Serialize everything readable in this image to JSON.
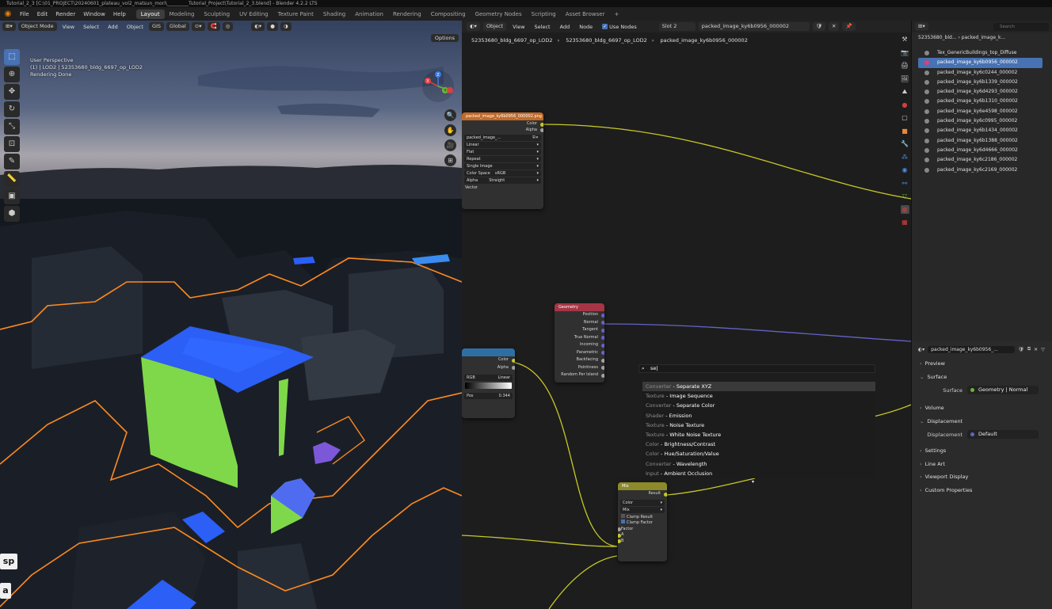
{
  "titlebar": {
    "text": "Tutorial_2_3 [C:\\01_PROJECT\\20240601_plateau_vol2_matsun_mori\\_________Tutorial_Project\\Tutorial_2_3.blend] - Blender 4.2.2 LTS"
  },
  "topbar": {
    "menus": [
      "File",
      "Edit",
      "Render",
      "Window",
      "Help"
    ],
    "workspaces": [
      "Layout",
      "Modeling",
      "Sculpting",
      "UV Editing",
      "Texture Paint",
      "Shading",
      "Animation",
      "Rendering",
      "Compositing",
      "Geometry Nodes",
      "Scripting",
      "Asset Browser"
    ],
    "add_tab": "+",
    "active_workspace": "Layout"
  },
  "viewport": {
    "mode": "Object Mode",
    "menus": [
      "View",
      "Select",
      "Add",
      "Object"
    ],
    "gis_label": "GIS",
    "orientation": "Global",
    "options_label": "Options",
    "info_lines": [
      "User Perspective",
      "(1) | LOD2 | 52353680_bldg_6697_op_LOD2",
      "Rendering Done"
    ],
    "key_overlays": [
      "sp",
      "a"
    ],
    "gizmo_labels": {
      "z": "Z",
      "y": "Y",
      "x": "X"
    }
  },
  "node_editor": {
    "editor_type": "Object",
    "menus": [
      "View",
      "Select",
      "Add",
      "Node"
    ],
    "use_nodes_label": "Use Nodes",
    "slot": "Slot 2",
    "material": "packed_image_ky6b0956_000002",
    "breadcrumb": [
      "52353680_bldg_6697_op_LOD2",
      "52353680_bldg_6697_op_LOD2",
      "packed_image_ky6b0956_000002"
    ],
    "image_node": {
      "title": "packed_image_ky6b0956_000002.png",
      "outputs": [
        "Color",
        "Alpha"
      ],
      "image_name": "packed_image_...",
      "interpolation": "Linear",
      "projection": "Flat",
      "extension": "Repeat",
      "source": "Single Image",
      "color_space_label": "Color Space",
      "color_space": "sRGB",
      "alpha_label": "Alpha",
      "alpha_mode": "Straight",
      "vector_label": "Vector"
    },
    "geometry_node": {
      "title": "Geometry",
      "outputs": [
        "Position",
        "Normal",
        "Tangent",
        "True Normal",
        "Incoming",
        "Parametric",
        "Backfacing",
        "Pointiness",
        "Random Per Island"
      ]
    },
    "ramp_node": {
      "outputs": [
        "Color",
        "Alpha"
      ],
      "mode": "RGB",
      "interp": "Linear",
      "pos_label": "Pos",
      "pos_value": "0.344"
    },
    "mix_node": {
      "title": "Mix",
      "output": "Result",
      "data_type": "Color",
      "blend": "Mix",
      "clamp_result": "Clamp Result",
      "clamp_factor": "Clamp Factor",
      "inputs": [
        "Factor",
        "A",
        "B"
      ]
    },
    "search": {
      "query": "se",
      "results": [
        {
          "category": "Converter",
          "name": "Separate XYZ"
        },
        {
          "category": "Texture",
          "name": "Image Sequence"
        },
        {
          "category": "Converter",
          "name": "Separate Color"
        },
        {
          "category": "Shader",
          "name": "Emission"
        },
        {
          "category": "Texture",
          "name": "Noise Texture"
        },
        {
          "category": "Texture",
          "name": "White Noise Texture"
        },
        {
          "category": "Color",
          "name": "Brightness/Contrast"
        },
        {
          "category": "Color",
          "name": "Hue/Saturation/Value"
        },
        {
          "category": "Converter",
          "name": "Wavelength"
        },
        {
          "category": "Input",
          "name": "Ambient Occlusion"
        }
      ]
    }
  },
  "outliner": {
    "search_placeholder": "Search",
    "breadcrumb": [
      "52353680_bld...",
      "packed_image_k..."
    ],
    "items": [
      "Tex_GenericBuildings_top_Diffuse",
      "packed_image_ky6b0956_000002",
      "packed_image_ky6c0244_000002",
      "packed_image_ky6b1339_000002",
      "packed_image_ky6d4293_000002",
      "packed_image_ky6b1310_000002",
      "packed_image_ky6e4598_000002",
      "packed_image_ky6c0995_000002",
      "packed_image_ky6b1434_000002",
      "packed_image_ky6b1388_000002",
      "packed_image_ky6d4666_000002",
      "packed_image_ky6c2186_000002",
      "packed_image_ky6c2169_000002"
    ],
    "selected_index": 1
  },
  "properties": {
    "material_name": "packed_image_ky6b0956_...",
    "panels": {
      "preview": "Preview",
      "surface": "Surface",
      "surface_label": "Surface",
      "surface_value": "Geometry | Normal",
      "volume": "Volume",
      "displacement": "Displacement",
      "displacement_label": "Displacement",
      "displacement_value": "Default",
      "settings": "Settings",
      "line_art": "Line Art",
      "viewport_display": "Viewport Display",
      "custom_properties": "Custom Properties"
    }
  },
  "colors": {
    "accent": "#4772b3",
    "image_header": "#c06a2a",
    "geometry_header": "#a53545",
    "ramp_header": "#2e6fa3",
    "mix_header": "#8c8a2a",
    "color_socket": "#c7c729",
    "vector_socket": "#6363c7",
    "float_socket": "#a1a1a1",
    "selection_outline": "#ff8a1f",
    "building_top": "#2b5ff5",
    "building_side": "#7fd84a"
  }
}
